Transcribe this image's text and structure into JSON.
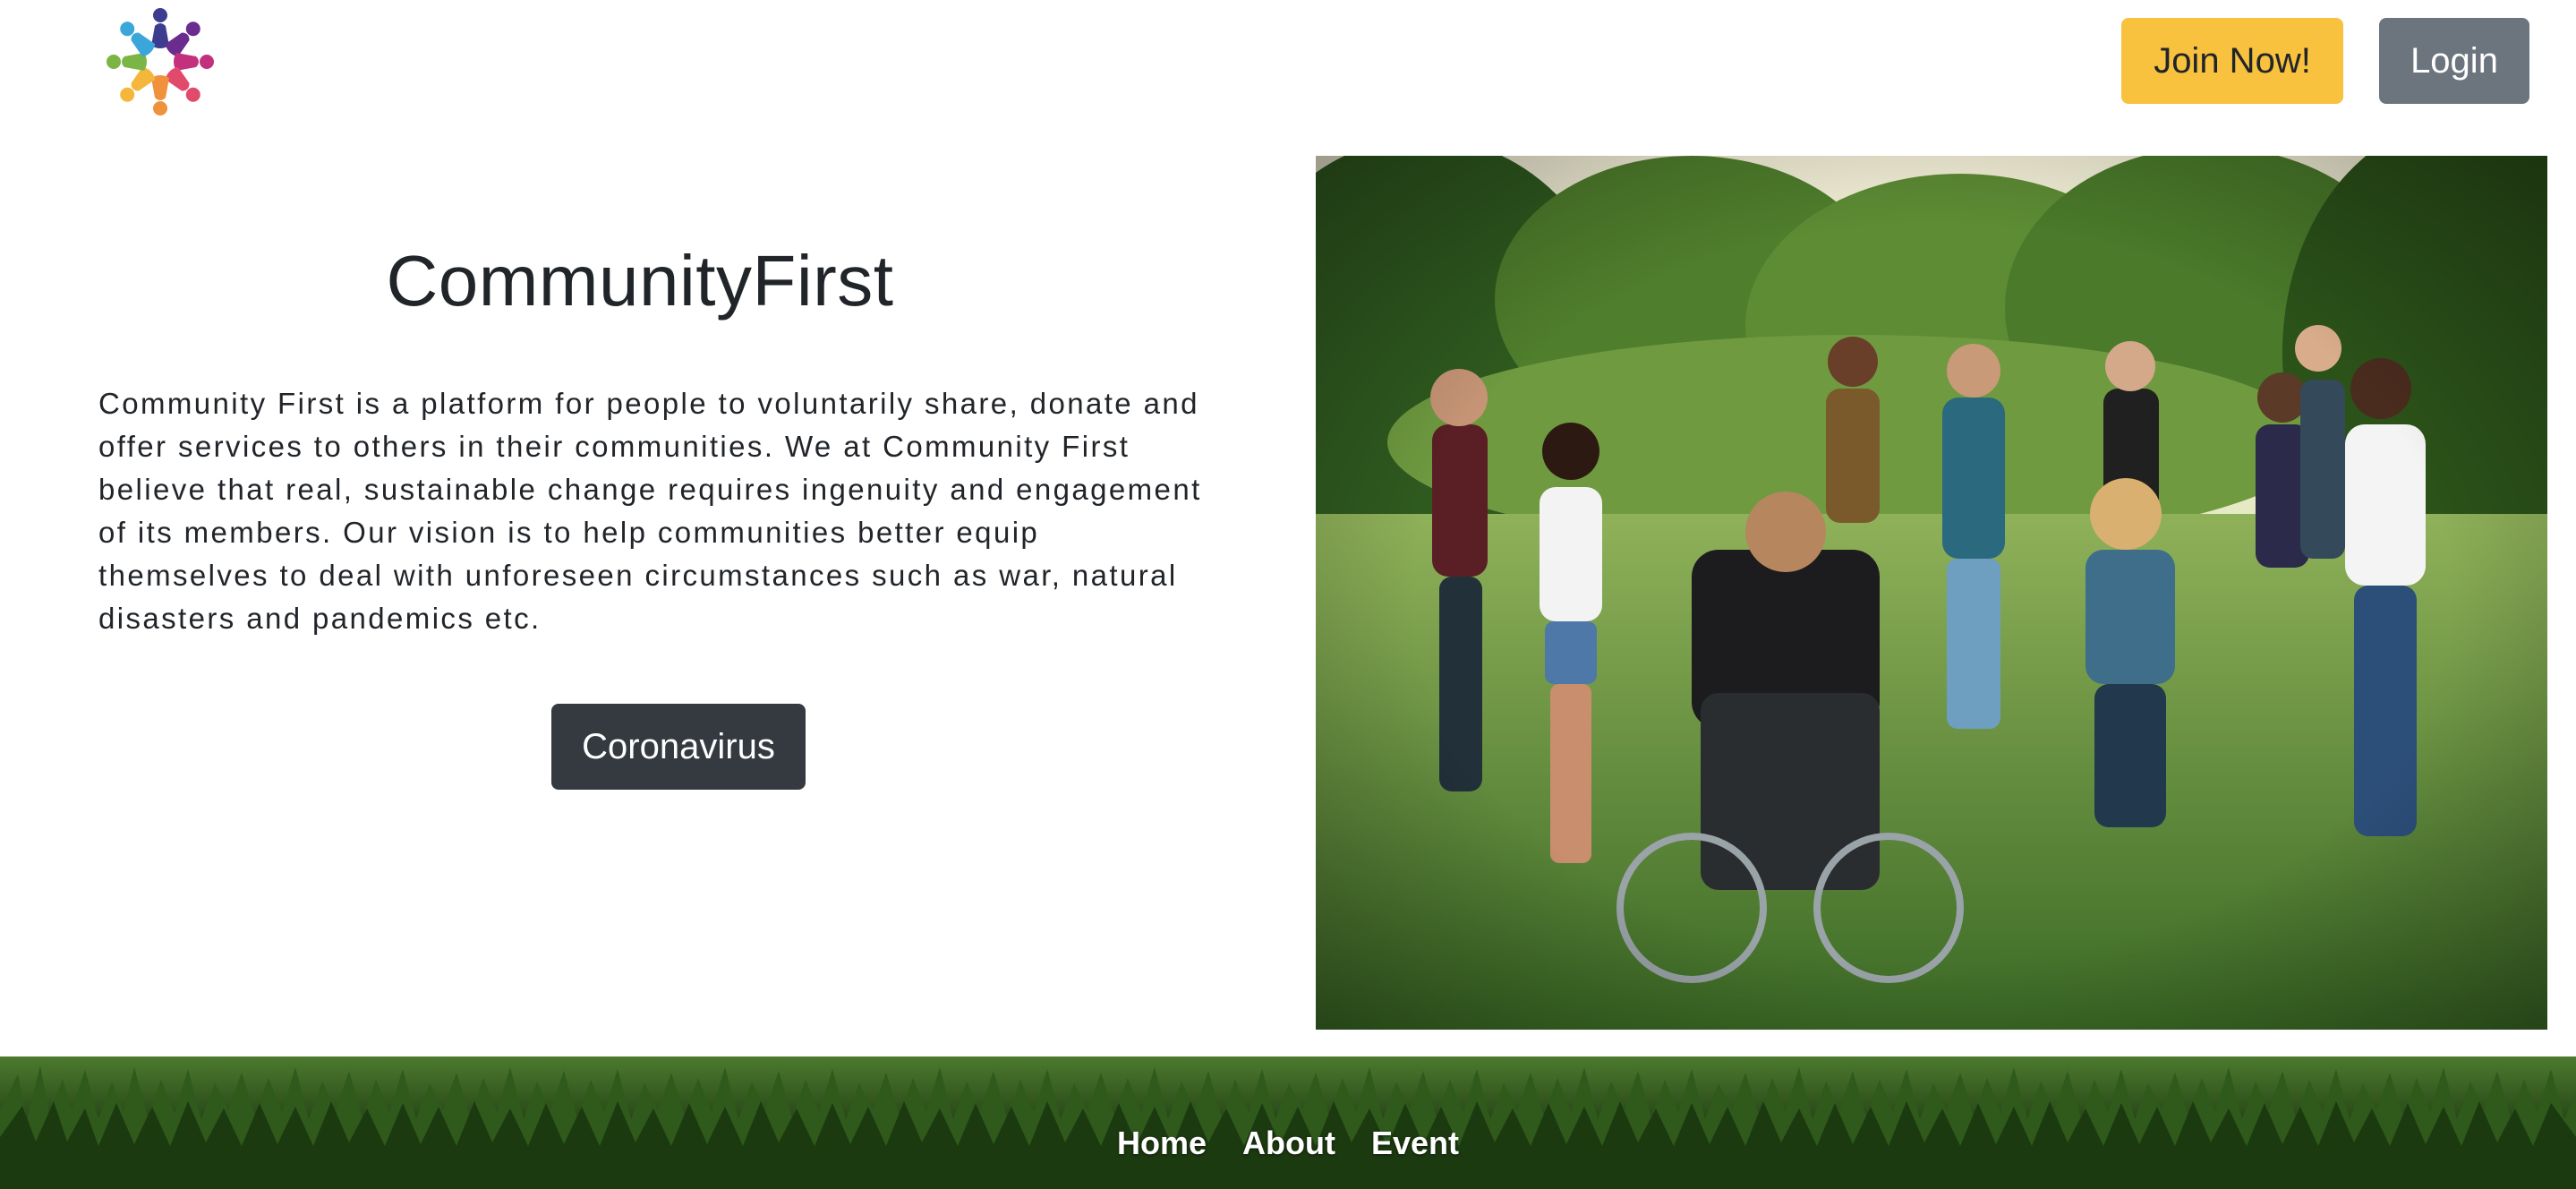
{
  "header": {
    "logo_icon": "community-people-circle-logo",
    "join_label": "Join Now!",
    "login_label": "Login"
  },
  "hero": {
    "title": "CommunityFirst",
    "description": "Community First is a platform for people to voluntarily share, donate and offer services to others in their communities. We at Community First believe that real, sustainable change requires ingenuity and engagement of its members. Our vision is to help communities better equip themselves to deal with unforeseen circumstances such as war, natural disasters and pandemics etc.",
    "coronavirus_label": "Coronavirus",
    "image_icon": "people-holding-hands-in-circle-photo"
  },
  "footer": {
    "nav": [
      "Home",
      "About",
      "Event"
    ]
  },
  "colors": {
    "join_button": "#f8c13e",
    "login_button": "#6c757d",
    "coronavirus_button": "#343a40",
    "text": "#212529"
  }
}
